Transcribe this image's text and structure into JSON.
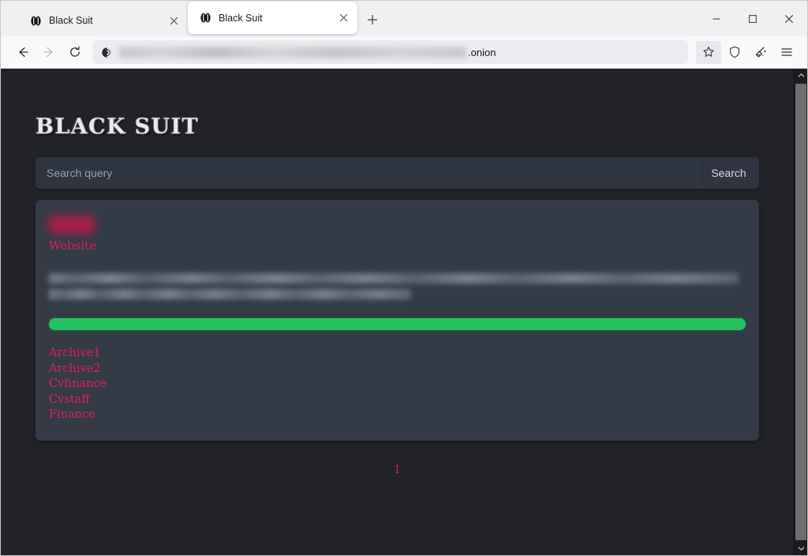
{
  "browser": {
    "tabs": [
      {
        "title": "Black Suit",
        "favicon": "black-suit-favicon",
        "active": false
      },
      {
        "title": "Black Suit",
        "favicon": "black-suit-favicon",
        "active": true
      }
    ],
    "new_tab_label": "+",
    "window_controls": {
      "minimize": "minimize-icon",
      "maximize": "maximize-icon",
      "close": "close-icon"
    },
    "nav": {
      "back": "back-arrow-icon",
      "forward": "forward-arrow-icon",
      "reload": "reload-icon"
    },
    "address_bar": {
      "security_icon": "tor-onion-icon",
      "url_redacted": true,
      "url_visible_suffix": ".onion"
    },
    "toolbar_icons": [
      "bookmark-star-icon",
      "shield-icon",
      "new-identity-broom-icon",
      "hamburger-menu-icon"
    ]
  },
  "page": {
    "logo": "BLACK SUIT",
    "search": {
      "placeholder": "Search query",
      "value": "",
      "button_label": "Search"
    },
    "result": {
      "title_redacted": true,
      "website_link_label": "Website",
      "description_redacted": true,
      "progress": {
        "percent": 100,
        "color": "#24c360"
      },
      "file_links": [
        "Archive1",
        "Archive2",
        "Cvfinance",
        "Cvstaff",
        "Finance"
      ]
    },
    "pagination": {
      "current": "1"
    },
    "colors": {
      "page_background": "#212329",
      "card_background": "#343b47",
      "search_background": "#2e3440",
      "accent_link": "#e01f55",
      "progress_green": "#24c360"
    }
  },
  "scrollbar": {
    "up_arrow": "scroll-up-icon",
    "down_arrow": "scroll-down-icon"
  }
}
